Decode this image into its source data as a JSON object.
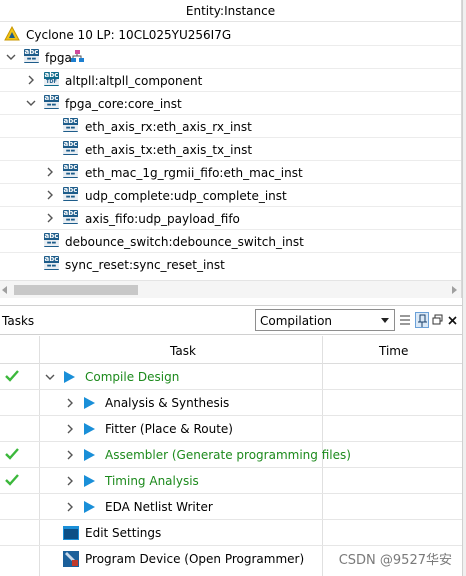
{
  "entity": {
    "header": "Entity:Instance",
    "device": "Cyclone 10 LP: 10CL025YU256I7G",
    "items": [
      {
        "label": "fpga"
      },
      {
        "label": "altpll:altpll_component"
      },
      {
        "label": "fpga_core:core_inst"
      },
      {
        "label": "eth_axis_rx:eth_axis_rx_inst"
      },
      {
        "label": "eth_axis_tx:eth_axis_tx_inst"
      },
      {
        "label": "eth_mac_1g_rgmii_fifo:eth_mac_inst"
      },
      {
        "label": "udp_complete:udp_complete_inst"
      },
      {
        "label": "axis_fifo:udp_payload_fifo"
      },
      {
        "label": "debounce_switch:debounce_switch_inst"
      },
      {
        "label": "sync_reset:sync_reset_inst"
      }
    ]
  },
  "tasks": {
    "title": "Tasks",
    "flow": "Compilation",
    "col_task": "Task",
    "col_time": "Time",
    "rows": [
      {
        "label": "Compile Design",
        "status": "done"
      },
      {
        "label": "Analysis & Synthesis",
        "status": "pending"
      },
      {
        "label": "Fitter (Place & Route)",
        "status": "pending"
      },
      {
        "label": "Assembler (Generate programming files)",
        "status": "done"
      },
      {
        "label": "Timing Analysis",
        "status": "done"
      },
      {
        "label": "EDA Netlist Writer",
        "status": "pending"
      },
      {
        "label": "Edit Settings",
        "status": "none"
      },
      {
        "label": "Program Device (Open Programmer)",
        "status": "none"
      }
    ]
  },
  "watermark": "CSDN @9527华安",
  "colors": {
    "done_green": "#1c8a1c",
    "check_green": "#3cb83c",
    "play_blue": "#1a8fd8",
    "abc_blue": "#1d5c8a"
  }
}
